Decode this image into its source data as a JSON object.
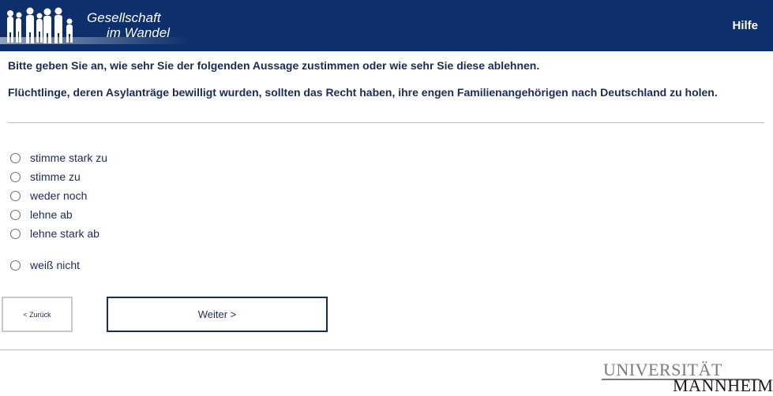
{
  "header": {
    "logo_line1": "Gesellschaft",
    "logo_line2": "im Wandel",
    "help_label": "Hilfe"
  },
  "question": {
    "instruction": "Bitte geben Sie an, wie sehr Sie der folgenden Aussage zustimmen oder wie sehr Sie diese ablehnen.",
    "statement": "Flüchtlinge, deren Asylanträge bewilligt wurden, sollten das Recht haben, ihre engen Familienangehörigen nach Deutschland zu holen."
  },
  "options": [
    {
      "label": "stimme stark zu"
    },
    {
      "label": "stimme zu"
    },
    {
      "label": "weder noch"
    },
    {
      "label": "lehne ab"
    },
    {
      "label": "lehne stark ab"
    },
    {
      "label": "weiß nicht"
    }
  ],
  "navigation": {
    "back_label": "< Zurück",
    "next_label": "Weiter >"
  },
  "footer": {
    "university_line1": "UNIVERSITÄT",
    "university_line2": "MANNHEIM"
  },
  "colors": {
    "header_bg": "#0d2f6b",
    "text": "#1a2c55"
  }
}
